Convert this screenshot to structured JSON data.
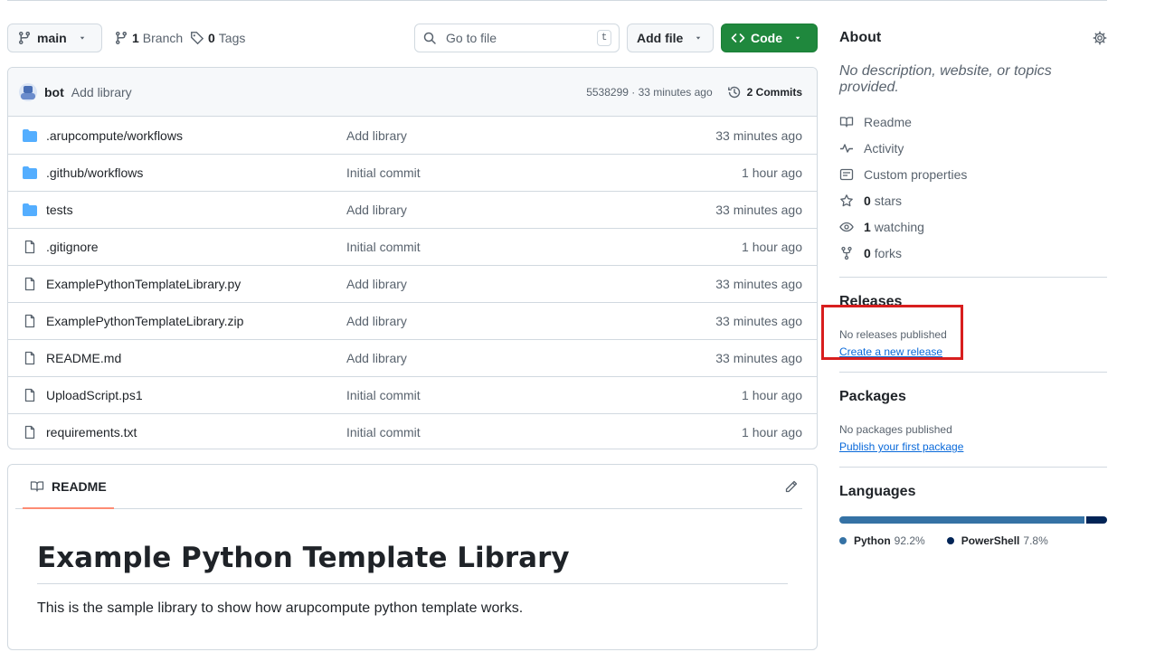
{
  "toolbar": {
    "branch_label": "main",
    "branches_count": "1",
    "branches_label": "Branch",
    "tags_count": "0",
    "tags_label": "Tags",
    "search_placeholder": "Go to file",
    "search_shortcut": "t",
    "add_file_label": "Add file",
    "code_label": "Code"
  },
  "commit": {
    "author": "bot",
    "message": "Add library",
    "hash_time": "5538299 · 33 minutes ago",
    "commits_label": "2 Commits"
  },
  "files": [
    {
      "type": "folder",
      "name": ".arupcompute/workflows",
      "message": "Add library",
      "age": "33 minutes ago"
    },
    {
      "type": "folder",
      "name": ".github/workflows",
      "message": "Initial commit",
      "age": "1 hour ago"
    },
    {
      "type": "folder",
      "name": "tests",
      "message": "Add library",
      "age": "33 minutes ago"
    },
    {
      "type": "file",
      "name": ".gitignore",
      "message": "Initial commit",
      "age": "1 hour ago"
    },
    {
      "type": "file",
      "name": "ExamplePythonTemplateLibrary.py",
      "message": "Add library",
      "age": "33 minutes ago"
    },
    {
      "type": "file",
      "name": "ExamplePythonTemplateLibrary.zip",
      "message": "Add library",
      "age": "33 minutes ago"
    },
    {
      "type": "file",
      "name": "README.md",
      "message": "Add library",
      "age": "33 minutes ago"
    },
    {
      "type": "file",
      "name": "UploadScript.ps1",
      "message": "Initial commit",
      "age": "1 hour ago"
    },
    {
      "type": "file",
      "name": "requirements.txt",
      "message": "Initial commit",
      "age": "1 hour ago"
    }
  ],
  "readme": {
    "tab_label": "README",
    "title": "Example Python Template Library",
    "body": "This is the sample library to show how arupcompute python template works."
  },
  "about": {
    "heading": "About",
    "description": "No description, website, or topics provided.",
    "readme_label": "Readme",
    "activity_label": "Activity",
    "custom_props_label": "Custom properties",
    "stars_count": "0",
    "stars_label": "stars",
    "watching_count": "1",
    "watching_label": "watching",
    "forks_count": "0",
    "forks_label": "forks"
  },
  "releases": {
    "heading": "Releases",
    "empty_text": "No releases published",
    "create_link": "Create a new release"
  },
  "packages": {
    "heading": "Packages",
    "empty_text": "No packages published",
    "publish_link": "Publish your first package"
  },
  "languages": {
    "heading": "Languages",
    "items": [
      {
        "name": "Python",
        "percent": "92.2%",
        "value": 92.2,
        "color": "#3572A5"
      },
      {
        "name": "PowerShell",
        "percent": "7.8%",
        "value": 7.8,
        "color": "#012456"
      }
    ]
  },
  "colors": {
    "code_button": "#1f883d",
    "link": "#0969da",
    "folder_icon": "#54aeff",
    "highlight_box": "#d81e1e"
  }
}
